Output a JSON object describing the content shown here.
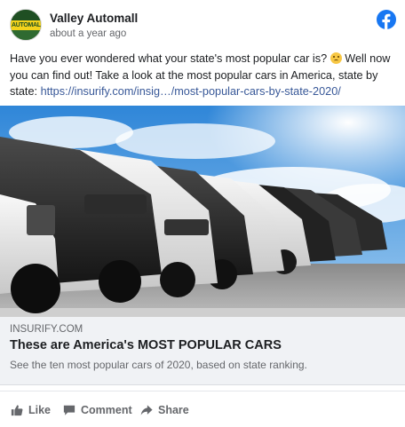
{
  "post": {
    "page_name": "Valley Automall",
    "avatar_text": "AUTOMALL",
    "timestamp": "about a year ago",
    "text_before_emoji": "Have you ever wondered what your state's most popular car is? ",
    "text_after_emoji": " Well now you can find out! Take a look at the most popular cars in America, state by state: ",
    "link_text": "https://insurify.com/insig…/most-popular-cars-by-state-2020/",
    "emoji": "thinking-face"
  },
  "link_preview": {
    "domain": "INSURIFY.COM",
    "title": "These are America's MOST POPULAR CARS",
    "description": "See the ten most popular cars of 2020, based on state ranking."
  },
  "actions": {
    "like": "Like",
    "comment": "Comment",
    "share": "Share"
  },
  "icons": [
    "facebook-logo-icon",
    "like-icon",
    "comment-icon",
    "share-icon"
  ],
  "colors": {
    "facebook_blue": "#1877f2",
    "link": "#385898",
    "secondary_text": "#65676b",
    "preview_bg": "#f0f2f5"
  }
}
